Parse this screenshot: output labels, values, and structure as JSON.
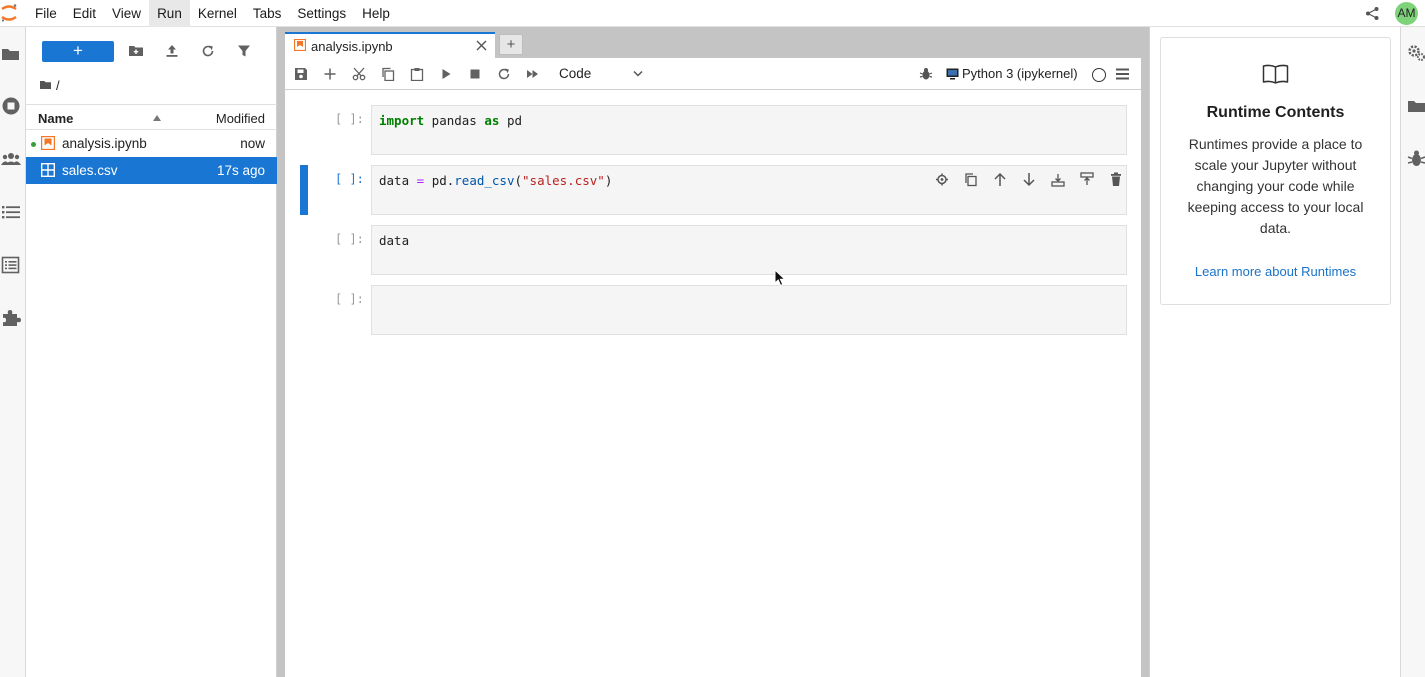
{
  "menubar": {
    "items": [
      "File",
      "Edit",
      "View",
      "Run",
      "Kernel",
      "Tabs",
      "Settings",
      "Help"
    ],
    "active_index": 3,
    "avatar_initials": "AM",
    "avatar_color": "#7ed37a",
    "icons": [
      "jupyter-logo",
      "share-icon"
    ]
  },
  "left_sidebar": {
    "icons": [
      "folder-icon",
      "running-kernels-icon",
      "collaborators-icon",
      "toc-icon",
      "property-inspector-icon",
      "extensions-icon"
    ]
  },
  "file_browser": {
    "new_button_label": "+",
    "toolbar_icons": [
      "new-folder-icon",
      "upload-icon",
      "refresh-icon",
      "filter-icon"
    ],
    "breadcrumb": "/",
    "columns": {
      "name": "Name",
      "modified": "Modified"
    },
    "files": [
      {
        "name": "analysis.ipynb",
        "modified": "now",
        "icon": "notebook-icon",
        "running": true,
        "selected": false
      },
      {
        "name": "sales.csv",
        "modified": "17s ago",
        "icon": "table-icon",
        "running": false,
        "selected": true
      }
    ]
  },
  "notebook": {
    "tab": {
      "label": "analysis.ipynb",
      "add_label": "+"
    },
    "toolbar": {
      "icons": [
        "save-icon",
        "add-cell-icon",
        "cut-icon",
        "copy-icon",
        "paste-icon",
        "run-icon",
        "stop-icon",
        "restart-icon",
        "run-all-icon"
      ],
      "cell_type": "Code",
      "kernel": "Python 3 (ipykernel)",
      "kernel_status": "idle"
    },
    "cells": [
      {
        "prompt": "[ ]:",
        "code": "import pandas as pd",
        "active": false
      },
      {
        "prompt": "[ ]:",
        "code": "data = pd.read_csv(\"sales.csv\")",
        "active": true
      },
      {
        "prompt": "[ ]:",
        "code": "data",
        "active": false
      },
      {
        "prompt": "[ ]:",
        "code": "",
        "active": false
      }
    ],
    "cell_toolbar_icons": [
      "settings-cell-icon",
      "duplicate-icon",
      "move-up-icon",
      "move-down-icon",
      "insert-below-icon",
      "insert-above-icon",
      "delete-icon"
    ]
  },
  "right_panel": {
    "title": "Runtime Contents",
    "description": "Runtimes provide a place to scale your Jupyter without changing your code while keeping access to your local data.",
    "link": "Learn more about Runtimes",
    "icons": [
      "book-icon"
    ]
  },
  "right_sidebar": {
    "icons": [
      "gears-icon",
      "folder-icon",
      "debugger-icon"
    ]
  },
  "colors": {
    "accent": "#1976d2",
    "keyword": "#008000",
    "string": "#ba2121",
    "function": "#0055aa"
  }
}
